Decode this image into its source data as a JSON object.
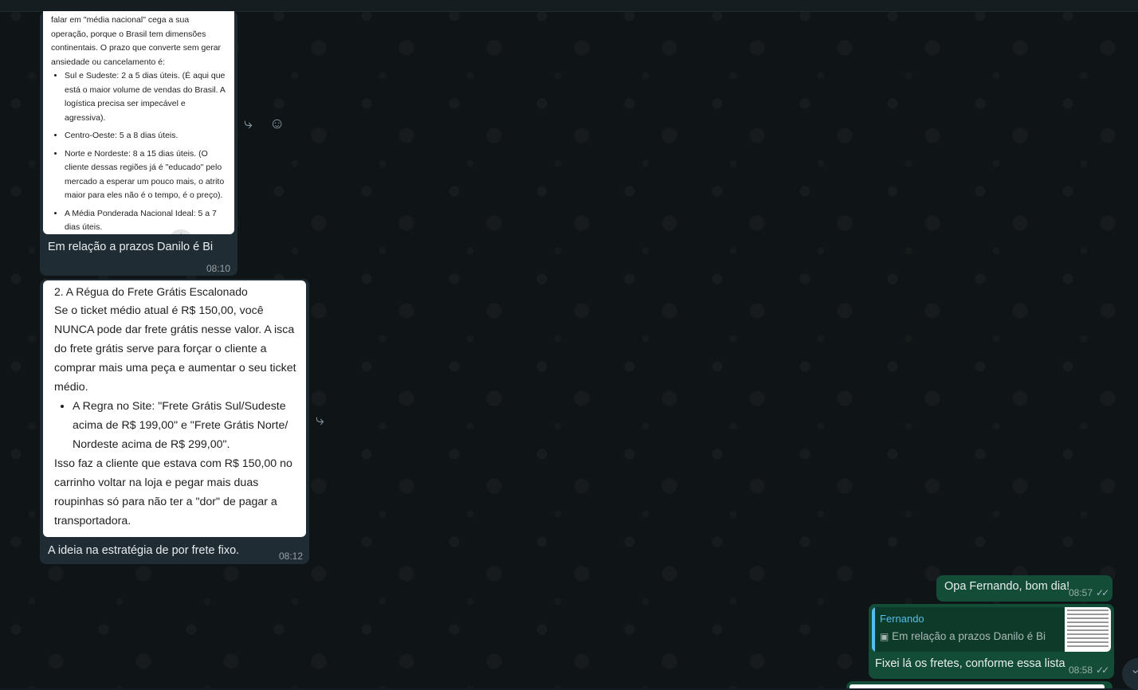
{
  "messages": {
    "msg1": {
      "image_text": {
        "intro": "falar em \"média nacional\" cega a sua operação, porque o Brasil tem dimensões continentais. O prazo que converte sem gerar ansiedade ou cancelamento é:",
        "items": [
          {
            "bold": "Sul e Sudeste: 2 a 5 dias úteis.",
            "rest": " (É aqui que está o maior volume de vendas do Brasil. A logística precisa ser impecável e agressiva)."
          },
          {
            "bold": "Centro-Oeste: 5 a 8 dias úteis.",
            "rest": ""
          },
          {
            "bold": "Norte e Nordeste: 8 a 15 dias úteis.",
            "rest": " (O cliente dessas regiões já é \"educado\" pelo mercado a esperar um pouco mais, o atrito maior para eles não é o tempo, é o preço)."
          },
          {
            "bold": "A Média Ponderada Nacional Ideal: 5 a 7 dias úteis.",
            "rest": ""
          }
        ]
      },
      "caption": "Em relação a prazos Danilo é Bi",
      "time": "08:10"
    },
    "msg2": {
      "image_text": {
        "heading": "2. A Régua do Frete Grátis Escalonado",
        "para1": "Se o ticket médio atual é R$ 150,00, você NUNCA pode dar frete grátis nesse valor. A isca do frete grátis serve para forçar o cliente a comprar mais uma peça e aumentar o seu ticket médio.",
        "bullet": "A Regra no Site: \"Frete Grátis Sul/Sudeste acima de R$ 199,00\" e \"Frete Grátis Norte/ Nordeste acima de R$ 299,00\".",
        "para2": "Isso faz a cliente que estava com R$ 150,00 no carrinho voltar na loja e pegar mais duas roupinhas só para não ter a \"dor\" de pagar a transportadora."
      },
      "caption": "A ideia na estratégia de por frete fixo.",
      "time": "08:12"
    },
    "msg3": {
      "text": "Opa Fernando, bom dia!",
      "time": "08:57"
    },
    "msg4": {
      "quote_author": "Fernando",
      "quote_text": "Em relação a prazos Danilo é Bi",
      "text": "Fixei lá os fretes, conforme essa lista",
      "time": "08:58"
    }
  },
  "icons": {
    "forward": "forward-icon",
    "emoji": "emoji-icon",
    "image": "image-icon",
    "read_ticks": "double-check-icon",
    "scroll_down": "chevron-down-icon"
  },
  "colors": {
    "incoming_bubble": "#1f2c33",
    "outgoing_bubble": "#144d37",
    "quote_accent": "#53bdeb",
    "chat_background": "#0f1416"
  }
}
